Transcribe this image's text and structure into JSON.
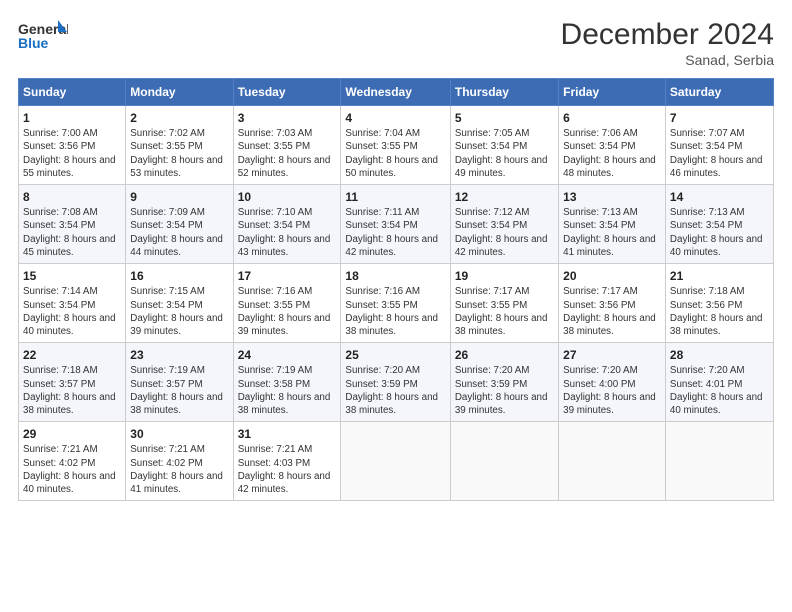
{
  "logo": {
    "general": "General",
    "blue": "Blue"
  },
  "header": {
    "month": "December 2024",
    "location": "Sanad, Serbia"
  },
  "weekdays": [
    "Sunday",
    "Monday",
    "Tuesday",
    "Wednesday",
    "Thursday",
    "Friday",
    "Saturday"
  ],
  "weeks": [
    [
      {
        "day": "1",
        "sunrise": "7:00 AM",
        "sunset": "3:56 PM",
        "daylight": "8 hours and 55 minutes."
      },
      {
        "day": "2",
        "sunrise": "7:02 AM",
        "sunset": "3:55 PM",
        "daylight": "8 hours and 53 minutes."
      },
      {
        "day": "3",
        "sunrise": "7:03 AM",
        "sunset": "3:55 PM",
        "daylight": "8 hours and 52 minutes."
      },
      {
        "day": "4",
        "sunrise": "7:04 AM",
        "sunset": "3:55 PM",
        "daylight": "8 hours and 50 minutes."
      },
      {
        "day": "5",
        "sunrise": "7:05 AM",
        "sunset": "3:54 PM",
        "daylight": "8 hours and 49 minutes."
      },
      {
        "day": "6",
        "sunrise": "7:06 AM",
        "sunset": "3:54 PM",
        "daylight": "8 hours and 48 minutes."
      },
      {
        "day": "7",
        "sunrise": "7:07 AM",
        "sunset": "3:54 PM",
        "daylight": "8 hours and 46 minutes."
      }
    ],
    [
      {
        "day": "8",
        "sunrise": "7:08 AM",
        "sunset": "3:54 PM",
        "daylight": "8 hours and 45 minutes."
      },
      {
        "day": "9",
        "sunrise": "7:09 AM",
        "sunset": "3:54 PM",
        "daylight": "8 hours and 44 minutes."
      },
      {
        "day": "10",
        "sunrise": "7:10 AM",
        "sunset": "3:54 PM",
        "daylight": "8 hours and 43 minutes."
      },
      {
        "day": "11",
        "sunrise": "7:11 AM",
        "sunset": "3:54 PM",
        "daylight": "8 hours and 42 minutes."
      },
      {
        "day": "12",
        "sunrise": "7:12 AM",
        "sunset": "3:54 PM",
        "daylight": "8 hours and 42 minutes."
      },
      {
        "day": "13",
        "sunrise": "7:13 AM",
        "sunset": "3:54 PM",
        "daylight": "8 hours and 41 minutes."
      },
      {
        "day": "14",
        "sunrise": "7:13 AM",
        "sunset": "3:54 PM",
        "daylight": "8 hours and 40 minutes."
      }
    ],
    [
      {
        "day": "15",
        "sunrise": "7:14 AM",
        "sunset": "3:54 PM",
        "daylight": "8 hours and 40 minutes."
      },
      {
        "day": "16",
        "sunrise": "7:15 AM",
        "sunset": "3:54 PM",
        "daylight": "8 hours and 39 minutes."
      },
      {
        "day": "17",
        "sunrise": "7:16 AM",
        "sunset": "3:55 PM",
        "daylight": "8 hours and 39 minutes."
      },
      {
        "day": "18",
        "sunrise": "7:16 AM",
        "sunset": "3:55 PM",
        "daylight": "8 hours and 38 minutes."
      },
      {
        "day": "19",
        "sunrise": "7:17 AM",
        "sunset": "3:55 PM",
        "daylight": "8 hours and 38 minutes."
      },
      {
        "day": "20",
        "sunrise": "7:17 AM",
        "sunset": "3:56 PM",
        "daylight": "8 hours and 38 minutes."
      },
      {
        "day": "21",
        "sunrise": "7:18 AM",
        "sunset": "3:56 PM",
        "daylight": "8 hours and 38 minutes."
      }
    ],
    [
      {
        "day": "22",
        "sunrise": "7:18 AM",
        "sunset": "3:57 PM",
        "daylight": "8 hours and 38 minutes."
      },
      {
        "day": "23",
        "sunrise": "7:19 AM",
        "sunset": "3:57 PM",
        "daylight": "8 hours and 38 minutes."
      },
      {
        "day": "24",
        "sunrise": "7:19 AM",
        "sunset": "3:58 PM",
        "daylight": "8 hours and 38 minutes."
      },
      {
        "day": "25",
        "sunrise": "7:20 AM",
        "sunset": "3:59 PM",
        "daylight": "8 hours and 38 minutes."
      },
      {
        "day": "26",
        "sunrise": "7:20 AM",
        "sunset": "3:59 PM",
        "daylight": "8 hours and 39 minutes."
      },
      {
        "day": "27",
        "sunrise": "7:20 AM",
        "sunset": "4:00 PM",
        "daylight": "8 hours and 39 minutes."
      },
      {
        "day": "28",
        "sunrise": "7:20 AM",
        "sunset": "4:01 PM",
        "daylight": "8 hours and 40 minutes."
      }
    ],
    [
      {
        "day": "29",
        "sunrise": "7:21 AM",
        "sunset": "4:02 PM",
        "daylight": "8 hours and 40 minutes."
      },
      {
        "day": "30",
        "sunrise": "7:21 AM",
        "sunset": "4:02 PM",
        "daylight": "8 hours and 41 minutes."
      },
      {
        "day": "31",
        "sunrise": "7:21 AM",
        "sunset": "4:03 PM",
        "daylight": "8 hours and 42 minutes."
      },
      null,
      null,
      null,
      null
    ]
  ],
  "labels": {
    "sunrise": "Sunrise:",
    "sunset": "Sunset:",
    "daylight": "Daylight:"
  }
}
